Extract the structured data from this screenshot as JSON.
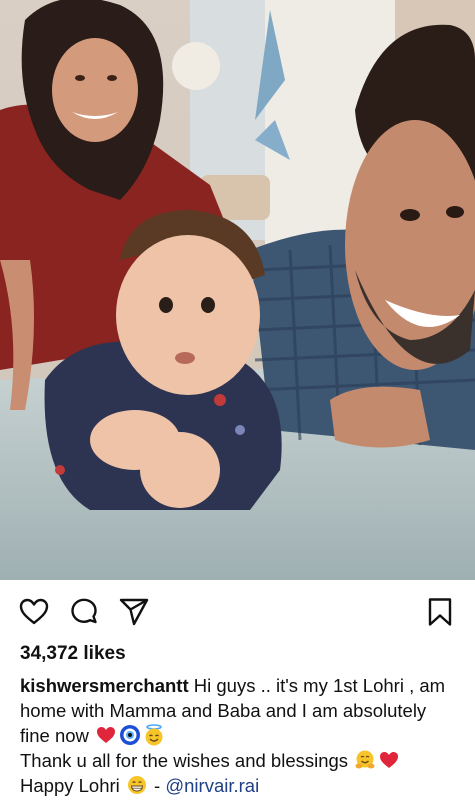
{
  "post": {
    "likes_count": "34,372 likes",
    "caption": {
      "username": "kishwersmerchantt",
      "line1": "Hi guys .. it's my 1st Lohri , am home with Mamma and Baba and I am absolutely fine now",
      "line2": "Thank u all for the wishes and blessings",
      "line3_prefix": "Happy Lohri",
      "line3_dash": " - ",
      "mention": "@nirvair.rai"
    }
  },
  "icons": {
    "like": "heart-outline-icon",
    "comment": "comment-bubble-icon",
    "share": "paper-plane-icon",
    "save": "bookmark-icon"
  },
  "colors": {
    "mention": "#1f3f86",
    "text": "#111111",
    "heart_emoji": "#e0263a"
  }
}
